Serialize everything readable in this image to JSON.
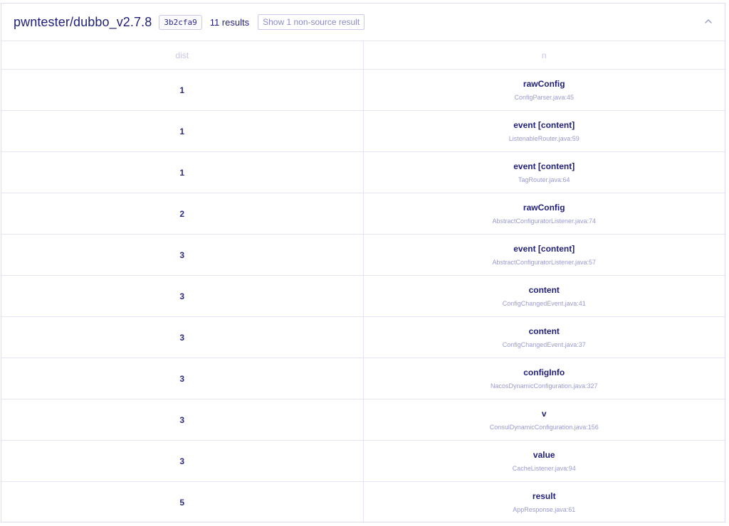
{
  "header": {
    "repo": "pwntester/dubbo_v2.7.8",
    "sha": "3b2cfa9",
    "results": "11 results",
    "nonsource_button": "Show 1 non-source result",
    "collapse_icon": "chevron-up-icon"
  },
  "table": {
    "columns": [
      "dist",
      "n"
    ],
    "rows": [
      {
        "dist": "1",
        "name": "rawConfig",
        "loc": "ConfigParser.java:45"
      },
      {
        "dist": "1",
        "name": "event [content]",
        "loc": "ListenableRouter.java:59"
      },
      {
        "dist": "1",
        "name": "event [content]",
        "loc": "TagRouter.java:64"
      },
      {
        "dist": "2",
        "name": "rawConfig",
        "loc": "AbstractConfiguratorListener.java:74"
      },
      {
        "dist": "3",
        "name": "event [content]",
        "loc": "AbstractConfiguratorListener.java:57"
      },
      {
        "dist": "3",
        "name": "content",
        "loc": "ConfigChangedEvent.java:41"
      },
      {
        "dist": "3",
        "name": "content",
        "loc": "ConfigChangedEvent.java:37"
      },
      {
        "dist": "3",
        "name": "configInfo",
        "loc": "NacosDynamicConfiguration.java:327"
      },
      {
        "dist": "3",
        "name": "v",
        "loc": "ConsulDynamicConfiguration.java:156"
      },
      {
        "dist": "3",
        "name": "value",
        "loc": "CacheListener.java:94"
      },
      {
        "dist": "5",
        "name": "result",
        "loc": "AppResponse.java:61"
      }
    ]
  }
}
